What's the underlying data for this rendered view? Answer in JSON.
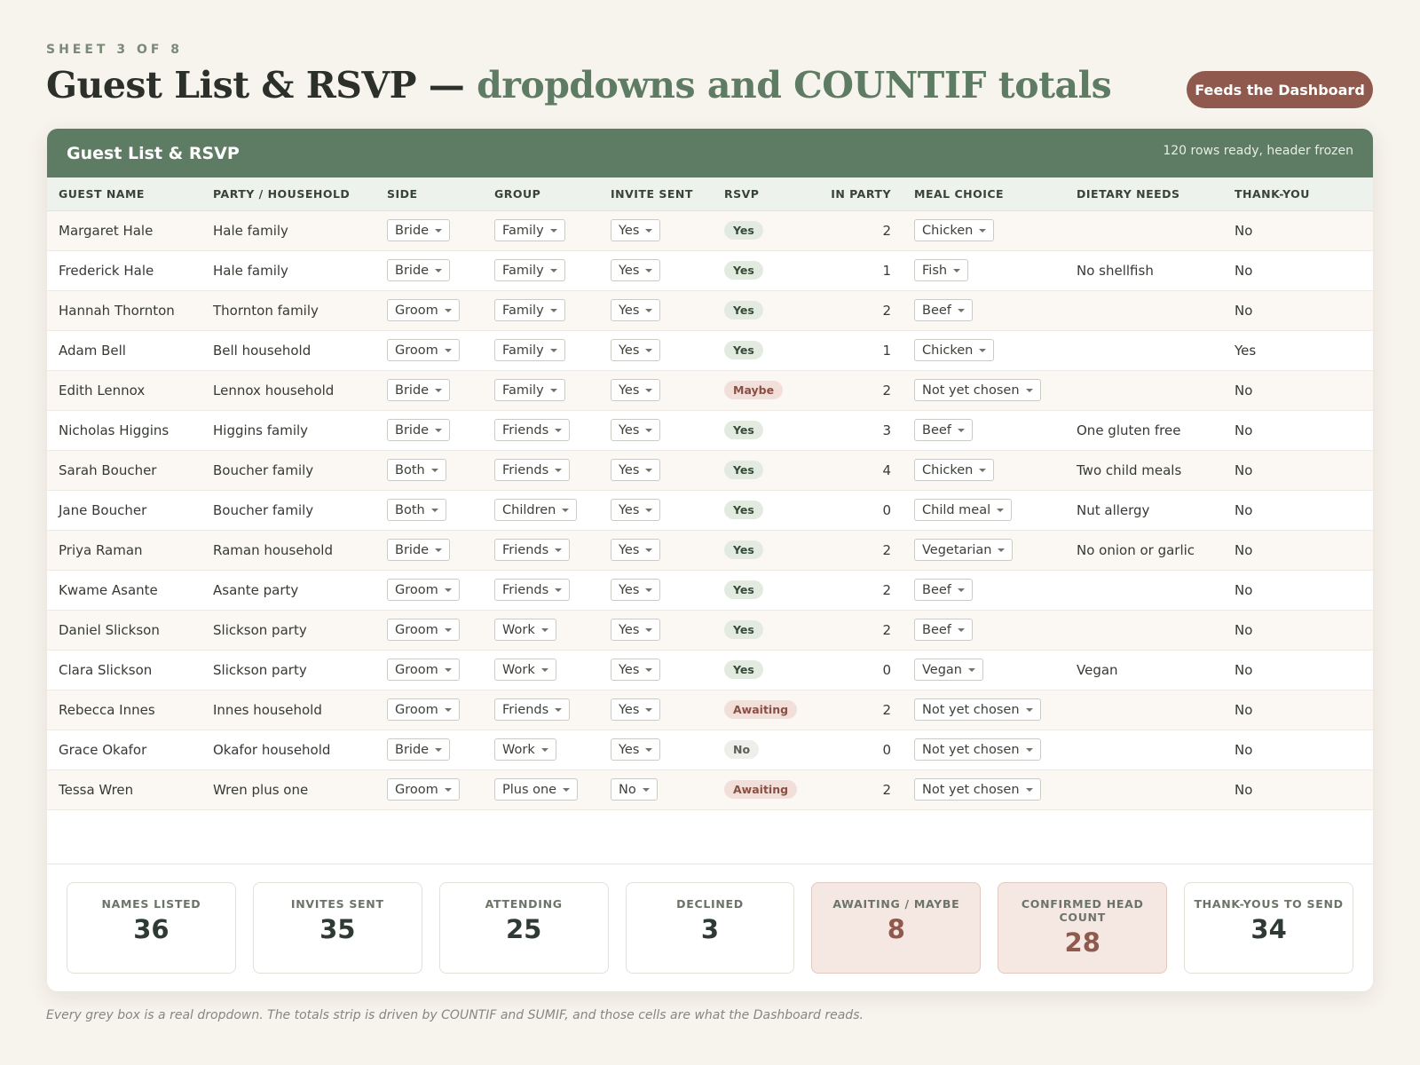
{
  "eyebrow": "SHEET 3 OF 8",
  "title": {
    "main": "Guest List & RSVP — ",
    "accent": "dropdowns and COUNTIF totals"
  },
  "feeds_button": "Feeds the Dashboard",
  "sheet": {
    "title": "Guest List & RSVP",
    "status": "120 rows ready, header frozen",
    "columns": [
      "GUEST NAME",
      "PARTY / HOUSEHOLD",
      "SIDE",
      "GROUP",
      "INVITE SENT",
      "RSVP",
      "IN PARTY",
      "MEAL CHOICE",
      "DIETARY NEEDS",
      "THANK-YOU"
    ],
    "rows": [
      {
        "name": "Margaret Hale",
        "party": "Hale family",
        "side": "Bride",
        "group": "Family",
        "invite": "Yes",
        "rsvp": "Yes",
        "in_party": "2",
        "meal": "Chicken",
        "dietary": "",
        "thanks": "No"
      },
      {
        "name": "Frederick Hale",
        "party": "Hale family",
        "side": "Bride",
        "group": "Family",
        "invite": "Yes",
        "rsvp": "Yes",
        "in_party": "1",
        "meal": "Fish",
        "dietary": "No shellfish",
        "thanks": "No"
      },
      {
        "name": "Hannah Thornton",
        "party": "Thornton family",
        "side": "Groom",
        "group": "Family",
        "invite": "Yes",
        "rsvp": "Yes",
        "in_party": "2",
        "meal": "Beef",
        "dietary": "",
        "thanks": "No"
      },
      {
        "name": "Adam Bell",
        "party": "Bell household",
        "side": "Groom",
        "group": "Family",
        "invite": "Yes",
        "rsvp": "Yes",
        "in_party": "1",
        "meal": "Chicken",
        "dietary": "",
        "thanks": "Yes"
      },
      {
        "name": "Edith Lennox",
        "party": "Lennox household",
        "side": "Bride",
        "group": "Family",
        "invite": "Yes",
        "rsvp": "Maybe",
        "in_party": "2",
        "meal": "Not yet chosen",
        "dietary": "",
        "thanks": "No"
      },
      {
        "name": "Nicholas Higgins",
        "party": "Higgins family",
        "side": "Bride",
        "group": "Friends",
        "invite": "Yes",
        "rsvp": "Yes",
        "in_party": "3",
        "meal": "Beef",
        "dietary": "One gluten free",
        "thanks": "No"
      },
      {
        "name": "Sarah Boucher",
        "party": "Boucher family",
        "side": "Both",
        "group": "Friends",
        "invite": "Yes",
        "rsvp": "Yes",
        "in_party": "4",
        "meal": "Chicken",
        "dietary": "Two child meals",
        "thanks": "No"
      },
      {
        "name": "Jane Boucher",
        "party": "Boucher family",
        "side": "Both",
        "group": "Children",
        "invite": "Yes",
        "rsvp": "Yes",
        "in_party": "0",
        "meal": "Child meal",
        "dietary": "Nut allergy",
        "thanks": "No"
      },
      {
        "name": "Priya Raman",
        "party": "Raman household",
        "side": "Bride",
        "group": "Friends",
        "invite": "Yes",
        "rsvp": "Yes",
        "in_party": "2",
        "meal": "Vegetarian",
        "dietary": "No onion or garlic",
        "thanks": "No"
      },
      {
        "name": "Kwame Asante",
        "party": "Asante party",
        "side": "Groom",
        "group": "Friends",
        "invite": "Yes",
        "rsvp": "Yes",
        "in_party": "2",
        "meal": "Beef",
        "dietary": "",
        "thanks": "No"
      },
      {
        "name": "Daniel Slickson",
        "party": "Slickson party",
        "side": "Groom",
        "group": "Work",
        "invite": "Yes",
        "rsvp": "Yes",
        "in_party": "2",
        "meal": "Beef",
        "dietary": "",
        "thanks": "No"
      },
      {
        "name": "Clara Slickson",
        "party": "Slickson party",
        "side": "Groom",
        "group": "Work",
        "invite": "Yes",
        "rsvp": "Yes",
        "in_party": "0",
        "meal": "Vegan",
        "dietary": "Vegan",
        "thanks": "No"
      },
      {
        "name": "Rebecca Innes",
        "party": "Innes household",
        "side": "Groom",
        "group": "Friends",
        "invite": "Yes",
        "rsvp": "Awaiting",
        "in_party": "2",
        "meal": "Not yet chosen",
        "dietary": "",
        "thanks": "No"
      },
      {
        "name": "Grace Okafor",
        "party": "Okafor household",
        "side": "Bride",
        "group": "Work",
        "invite": "Yes",
        "rsvp": "No",
        "in_party": "0",
        "meal": "Not yet chosen",
        "dietary": "",
        "thanks": "No"
      },
      {
        "name": "Tessa Wren",
        "party": "Wren plus one",
        "side": "Groom",
        "group": "Plus one",
        "invite": "No",
        "rsvp": "Awaiting",
        "in_party": "2",
        "meal": "Not yet chosen",
        "dietary": "",
        "thanks": "No"
      }
    ]
  },
  "totals": [
    {
      "label": "NAMES LISTED",
      "value": "36",
      "highlight": false
    },
    {
      "label": "INVITES SENT",
      "value": "35",
      "highlight": false
    },
    {
      "label": "ATTENDING",
      "value": "25",
      "highlight": false
    },
    {
      "label": "DECLINED",
      "value": "3",
      "highlight": false
    },
    {
      "label": "AWAITING / MAYBE",
      "value": "8",
      "highlight": true
    },
    {
      "label": "CONFIRMED HEAD COUNT",
      "value": "28",
      "highlight": true
    },
    {
      "label": "THANK-YOUS TO SEND",
      "value": "34",
      "highlight": false
    }
  ],
  "footnote": "Every grey box is a real dropdown. The totals strip is driven by COUNTIF and SUMIF, and those cells are what the Dashboard reads.",
  "colors": {
    "accent_green": "#5e7b63",
    "brand_brown": "#8f5a4d",
    "background": "#f7f3ed"
  }
}
